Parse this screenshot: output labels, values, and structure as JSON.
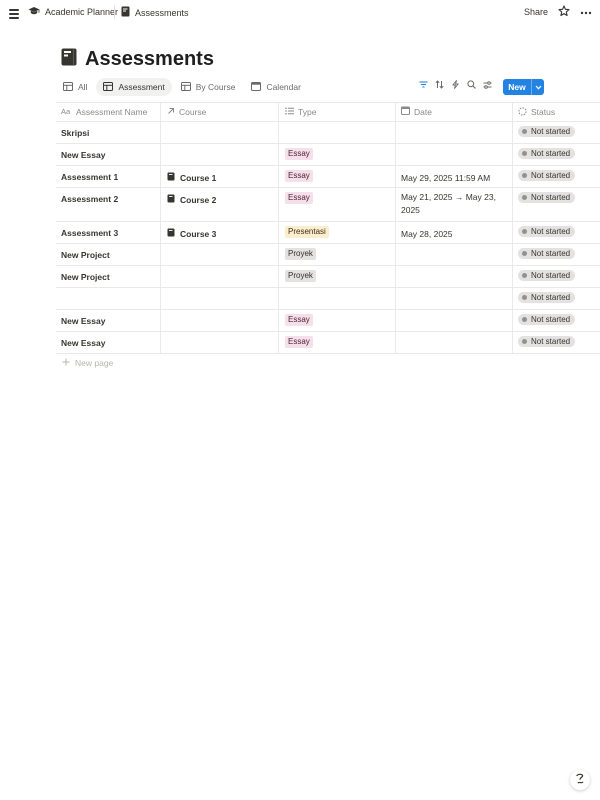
{
  "breadcrumb": {
    "workspace": "Academic Planner",
    "page": "Assessments"
  },
  "topbar": {
    "share_label": "Share"
  },
  "page_title": "Assessments",
  "views": [
    {
      "label": "All",
      "active": false
    },
    {
      "label": "Assessment",
      "active": true
    },
    {
      "label": "By Course",
      "active": false
    },
    {
      "label": "Calendar",
      "active": false
    }
  ],
  "toolbar": {
    "new_label": "New"
  },
  "columns": {
    "name": "Assessment Name",
    "course": "Course",
    "type": "Type",
    "date": "Date",
    "status": "Status"
  },
  "rows": [
    {
      "name": "Skripsi",
      "course": "",
      "type": "",
      "date": "",
      "status": "Not started"
    },
    {
      "name": "New Essay",
      "course": "",
      "type": "Essay",
      "date": "",
      "status": "Not started"
    },
    {
      "name": "Assessment 1",
      "course": "Course 1",
      "type": "Essay",
      "date": "May 29, 2025 11:59 AM",
      "status": "Not started"
    },
    {
      "name": "Assessment 2",
      "course": "Course 2",
      "type": "Essay",
      "date": "May 21, 2025 → May 23, 2025",
      "status": "Not started"
    },
    {
      "name": "Assessment 3",
      "course": "Course 3",
      "type": "Presentasi",
      "date": "May 28, 2025",
      "status": "Not started"
    },
    {
      "name": "New Project",
      "course": "",
      "type": "Proyek",
      "date": "",
      "status": "Not started"
    },
    {
      "name": "New Project",
      "course": "",
      "type": "Proyek",
      "date": "",
      "status": "Not started"
    },
    {
      "name": "",
      "course": "",
      "type": "",
      "date": "",
      "status": "Not started"
    },
    {
      "name": "New Essay",
      "course": "",
      "type": "Essay",
      "date": "",
      "status": "Not started"
    },
    {
      "name": "New Essay",
      "course": "",
      "type": "Essay",
      "date": "",
      "status": "Not started"
    }
  ],
  "new_page_label": "New page",
  "colors": {
    "accent": "#2383e2",
    "essay_bg": "#f5e0e9",
    "essay_fg": "#4c2337",
    "presentasi_bg": "#fbeecc",
    "presentasi_fg": "#402c1b",
    "proyek_bg": "#e3e2e0",
    "proyek_fg": "#32302c",
    "status_bg": "#e3e2e0"
  },
  "icons": {
    "menu": "hamburger-icon",
    "workspace": "graduation-cap-icon",
    "page": "notebook-icon",
    "favorite": "star-icon",
    "more": "more-horizontal-icon",
    "filter": "filter-icon",
    "sort": "sort-icon",
    "automation": "lightning-icon",
    "search": "search-icon",
    "settings": "sliders-icon",
    "help": "help-icon"
  }
}
